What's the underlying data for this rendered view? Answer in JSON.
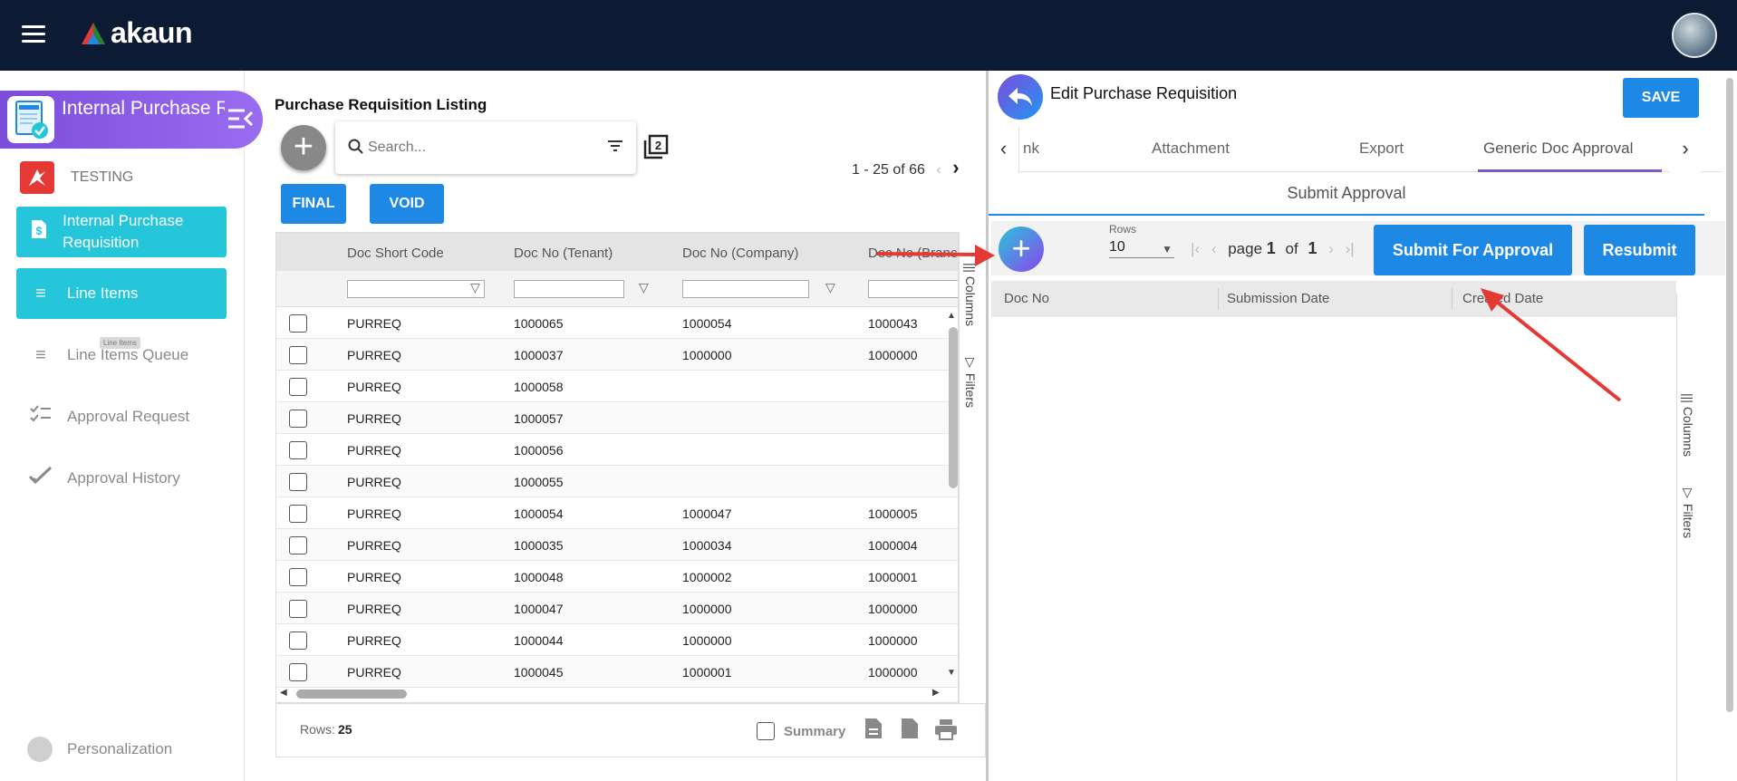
{
  "topbar": {
    "brand": "akaun"
  },
  "sidebar": {
    "applet_title": "Internal Purchase Requisition Applet",
    "tenant_label": "TESTING",
    "items": [
      {
        "label": "Internal Purchase Requisition",
        "icon": "dollar-doc-icon",
        "active": true
      },
      {
        "label": "Line Items",
        "icon": "list-icon",
        "active": true
      },
      {
        "label": "Line Items Queue",
        "icon": "list-icon",
        "active": false
      },
      {
        "label": "Approval Request",
        "icon": "checklist-icon",
        "active": false
      },
      {
        "label": "Approval History",
        "icon": "double-check-icon",
        "active": false
      }
    ],
    "tooltip": "Line Items",
    "personalization": "Personalization"
  },
  "listing": {
    "title": "Purchase Requisition Listing",
    "search_placeholder": "Search...",
    "pager": "1 - 25 of 66",
    "final_label": "FINAL",
    "void_label": "VOID",
    "columns": [
      "Doc Short Code",
      "Doc No (Tenant)",
      "Doc No (Company)",
      "Doc No (Branch)"
    ],
    "rows": [
      [
        "PURREQ",
        "1000065",
        "1000054",
        "1000043"
      ],
      [
        "PURREQ",
        "1000037",
        "1000000",
        "1000000"
      ],
      [
        "PURREQ",
        "1000058",
        "",
        ""
      ],
      [
        "PURREQ",
        "1000057",
        "",
        ""
      ],
      [
        "PURREQ",
        "1000056",
        "",
        ""
      ],
      [
        "PURREQ",
        "1000055",
        "",
        ""
      ],
      [
        "PURREQ",
        "1000054",
        "1000047",
        "1000005"
      ],
      [
        "PURREQ",
        "1000035",
        "1000034",
        "1000004"
      ],
      [
        "PURREQ",
        "1000048",
        "1000002",
        "1000001"
      ],
      [
        "PURREQ",
        "1000047",
        "1000000",
        "1000000"
      ],
      [
        "PURREQ",
        "1000044",
        "1000000",
        "1000000"
      ],
      [
        "PURREQ",
        "1000045",
        "1000001",
        "1000000"
      ]
    ],
    "side_tabs": [
      "Columns",
      "Filters"
    ],
    "rows_label": "Rows:",
    "rows_value": "25",
    "summary_label": "Summary"
  },
  "edit": {
    "title": "Edit Purchase Requisition",
    "save_label": "SAVE",
    "tabs": [
      "nk",
      "Attachment",
      "Export",
      "Generic Doc Approval"
    ],
    "subtitle": "Submit Approval",
    "rows_label": "Rows",
    "rows_value": "10",
    "page_word": "page",
    "page_current": "1",
    "of_word": "of",
    "page_total": "1",
    "submit_label": "Submit For Approval",
    "resubmit_label": "Resubmit",
    "columns": [
      "Doc No",
      "Submission Date",
      "Created Date"
    ],
    "side_tabs": [
      "Columns",
      "Filters"
    ]
  },
  "colors": {
    "topbar": "#0c1b33",
    "accent": "#1e88e5",
    "nav_active": "#26c6da",
    "applet": "#8b5cf6",
    "annotation": "#e53935"
  }
}
